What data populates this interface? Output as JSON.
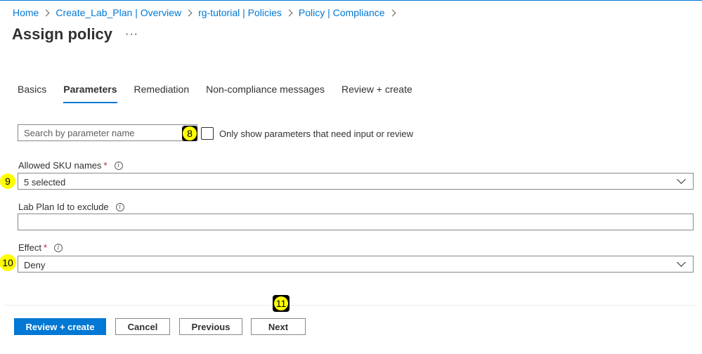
{
  "breadcrumb": [
    "Home",
    "Create_Lab_Plan | Overview",
    "rg-tutorial | Policies",
    "Policy | Compliance"
  ],
  "page": {
    "title": "Assign policy",
    "more": "···"
  },
  "tabs": [
    "Basics",
    "Parameters",
    "Remediation",
    "Non-compliance messages",
    "Review + create"
  ],
  "active_tab": "Parameters",
  "search": {
    "placeholder": "Search by parameter name",
    "value": ""
  },
  "filter_checkbox": {
    "label": "Only show parameters that need input or review",
    "checked": false
  },
  "fields": {
    "allowed_sku": {
      "label": "Allowed SKU names",
      "required": "*",
      "value": "5 selected"
    },
    "lab_plan_exclude": {
      "label": "Lab Plan Id to exclude",
      "value": ""
    },
    "effect": {
      "label": "Effect",
      "required": "*",
      "value": "Deny"
    }
  },
  "annotations": [
    "8",
    "9",
    "10",
    "11"
  ],
  "footer": {
    "review_create": "Review + create",
    "cancel": "Cancel",
    "previous": "Previous",
    "next": "Next"
  },
  "colors": {
    "accent": "#0078d4",
    "required": "#a4262c",
    "annotation": "#ffff00"
  }
}
